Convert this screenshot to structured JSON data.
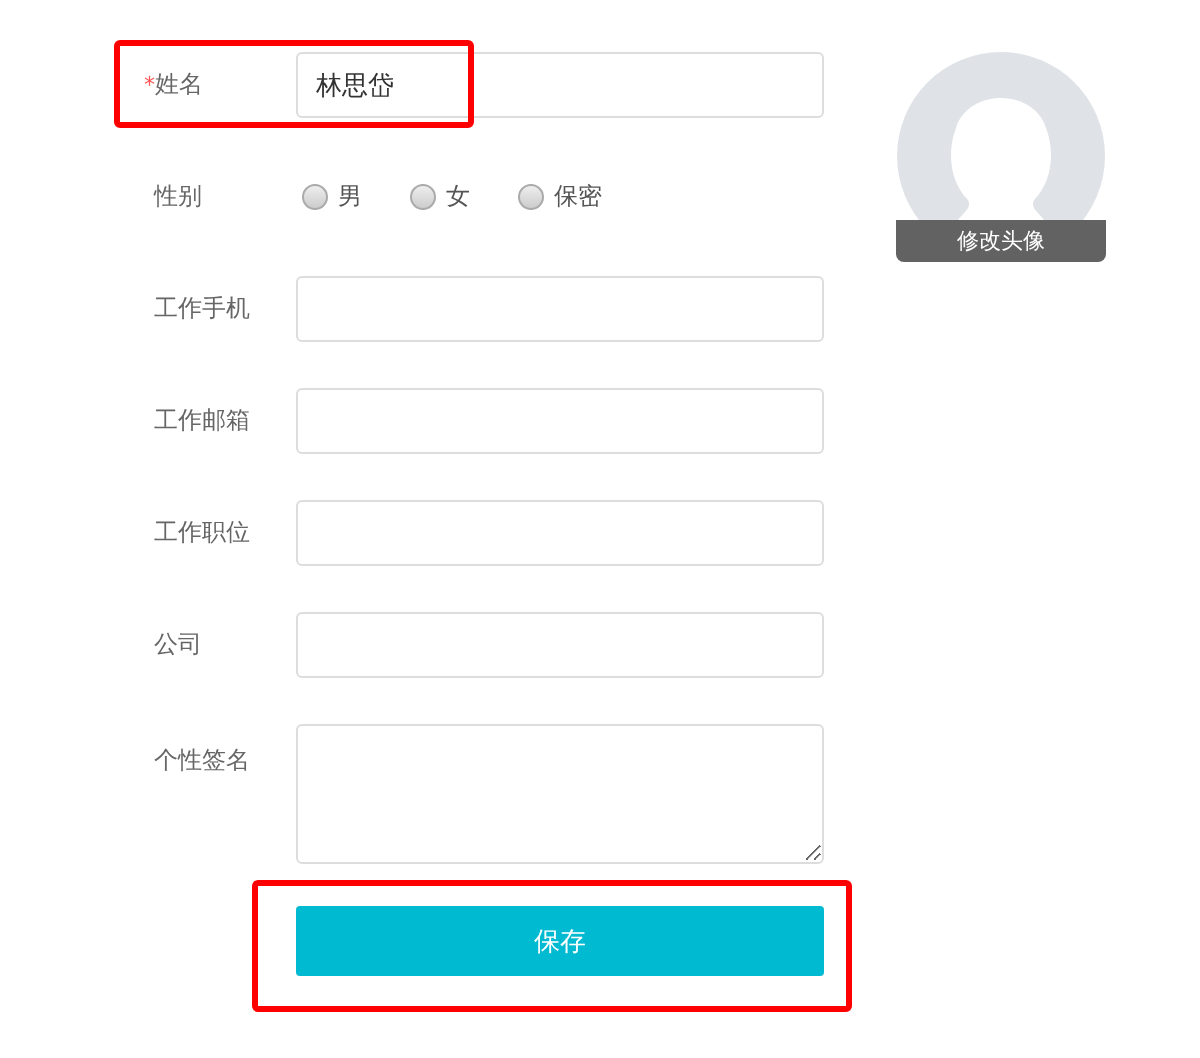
{
  "fields": [
    {
      "kind": "text",
      "label": "姓名",
      "required_mark": "*",
      "value": "林思岱",
      "highlighted": true
    },
    {
      "kind": "radio",
      "label": "性别",
      "options": [
        {
          "label": "男",
          "selected": false
        },
        {
          "label": "女",
          "selected": false
        },
        {
          "label": "保密",
          "selected": false
        }
      ]
    },
    {
      "kind": "text",
      "label": "工作手机"
    },
    {
      "kind": "text",
      "label": "工作邮箱"
    },
    {
      "kind": "text",
      "label": "工作职位"
    },
    {
      "kind": "text",
      "label": "公司"
    },
    {
      "kind": "textarea",
      "label": "个性签名"
    }
  ],
  "save_button": {
    "label": "保存",
    "highlighted": true
  },
  "avatar": {
    "caption": "修改头像"
  }
}
